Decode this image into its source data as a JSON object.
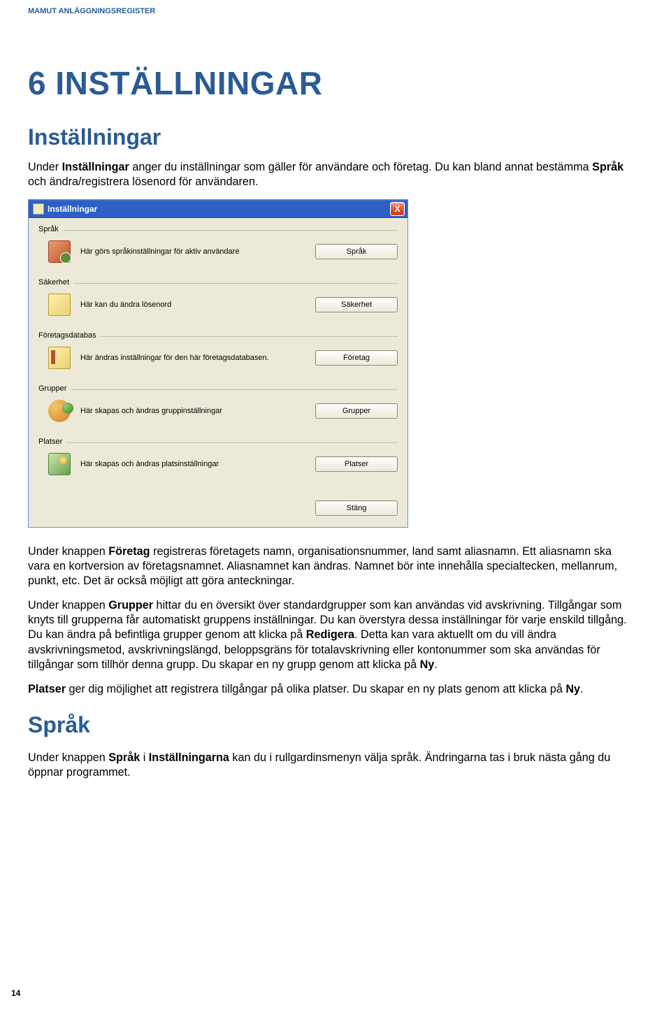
{
  "header": "MAMUT ANLÄGGNINGSREGISTER",
  "chapter_title": "6  INSTÄLLNINGAR",
  "section_title": "Inställningar",
  "intro": {
    "t1": "Under ",
    "b1": "Inställningar",
    "t2": " anger du inställningar som gäller för användare och företag. Du kan bland annat bestämma ",
    "b2": "Språk",
    "t3": " och ändra/registrera lösenord för användaren."
  },
  "dialog": {
    "title": "Inställningar",
    "close_label": "X",
    "groups": [
      {
        "title": "Språk",
        "desc": "Här görs språkinställningar för aktiv användare",
        "button": "Språk",
        "icon": "icon-sprak"
      },
      {
        "title": "Säkerhet",
        "desc": "Här kan du ändra lösenord",
        "button": "Säkerhet",
        "icon": "icon-sak"
      },
      {
        "title": "Företagsdatabas",
        "desc": "Här ändras inställningar för den här företagsdatabasen.",
        "button": "Företag",
        "icon": "icon-foretag"
      },
      {
        "title": "Grupper",
        "desc": "Här skapas och ändras gruppinställningar",
        "button": "Grupper",
        "icon": "icon-grupper"
      },
      {
        "title": "Platser",
        "desc": "Här skapas och ändras platsinställningar",
        "button": "Platser",
        "icon": "icon-platser"
      }
    ],
    "close_button": "Stäng"
  },
  "para_foretag": {
    "t1": "Under knappen ",
    "b1": "Företag",
    "t2": " registreras företagets namn, organisationsnummer, land samt aliasnamn. Ett aliasnamn ska vara en kortversion av företagsnamnet. Aliasnamnet kan ändras. Namnet bör inte innehålla specialtecken, mellanrum, punkt, etc. Det är också möjligt att göra anteckningar."
  },
  "para_grupper": {
    "t1": "Under knappen ",
    "b1": "Grupper",
    "t2": " hittar du en översikt över standardgrupper som kan användas vid avskrivning. Tillgångar som knyts till grupperna får automatiskt gruppens inställningar. Du kan överstyra dessa inställningar för varje enskild tillgång. Du kan ändra på befintliga grupper genom att klicka på ",
    "b2": "Redigera",
    "t3": ". Detta kan vara aktuellt om du vill ändra avskrivningsmetod, avskrivningslängd, beloppsgräns för totalavskrivning eller kontonummer som ska användas för tillgångar som tillhör denna grupp. Du skapar en ny grupp genom att klicka på ",
    "b3": "Ny",
    "t4": "."
  },
  "para_platser": {
    "b1": "Platser",
    "t1": " ger dig möjlighet att registrera tillgångar på olika platser. Du skapar en ny plats genom att klicka på ",
    "b2": "Ny",
    "t2": "."
  },
  "subsection_title": "Språk",
  "para_sprak": {
    "t1": "Under knappen ",
    "b1": "Språk",
    "t2": " i ",
    "b2": "Inställningarna",
    "t3": " kan du i rullgardinsmenyn välja språk. Ändringarna tas i bruk nästa gång du öppnar programmet."
  },
  "page_number": "14"
}
